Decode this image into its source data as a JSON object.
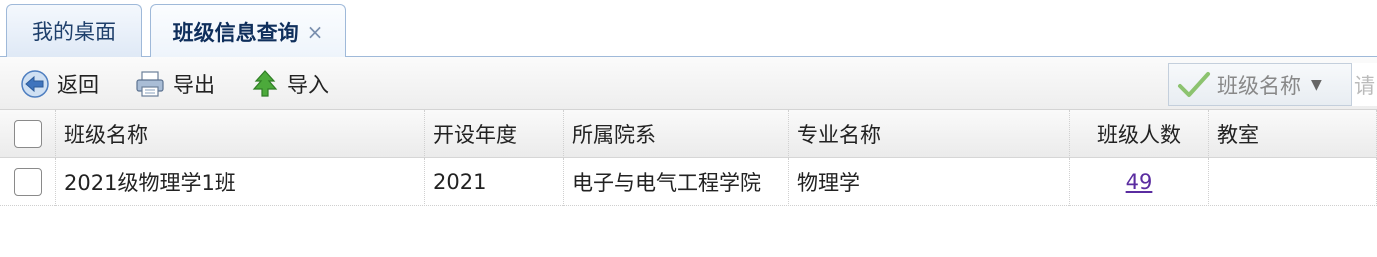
{
  "tabs": [
    {
      "label": "我的桌面"
    },
    {
      "label": "班级信息查询",
      "close": "×"
    }
  ],
  "toolbar": {
    "back_label": "返回",
    "export_label": "导出",
    "import_label": "导入",
    "filter_label": "班级名称",
    "search_placeholder": "请"
  },
  "table": {
    "headers": [
      "班级名称",
      "开设年度",
      "所属院系",
      "专业名称",
      "班级人数",
      "教室"
    ],
    "rows": [
      {
        "class_name": "2021级物理学1班",
        "year": "2021",
        "department": "电子与电气工程学院",
        "major": "物理学",
        "count": "49",
        "room": ""
      }
    ]
  },
  "colors": {
    "tab_border": "#9fb9d9",
    "accent": "#1e3f6b",
    "link": "#5a2ca0"
  },
  "icons": {
    "back": "arrow-left-icon",
    "export": "printer-icon",
    "import": "tree-import-icon",
    "filter": "checkmark-icon"
  }
}
